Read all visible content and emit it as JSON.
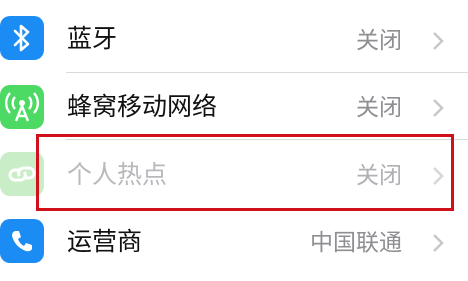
{
  "colors": {
    "bluetooth_icon": "#1a8cf3",
    "cellular_icon": "#4cd964",
    "hotspot_icon": "#c9edc7",
    "carrier_icon": "#1a8cf3",
    "highlight": "#d0111b"
  },
  "settings": {
    "items": [
      {
        "icon": "bluetooth-icon",
        "label": "蓝牙",
        "value": "关闭",
        "enabled": true
      },
      {
        "icon": "antenna-icon",
        "label": "蜂窝移动网络",
        "value": "关闭",
        "enabled": true
      },
      {
        "icon": "link-icon",
        "label": "个人热点",
        "value": "关闭",
        "enabled": false
      },
      {
        "icon": "phone-icon",
        "label": "运营商",
        "value": "中国联通",
        "enabled": true
      }
    ]
  }
}
